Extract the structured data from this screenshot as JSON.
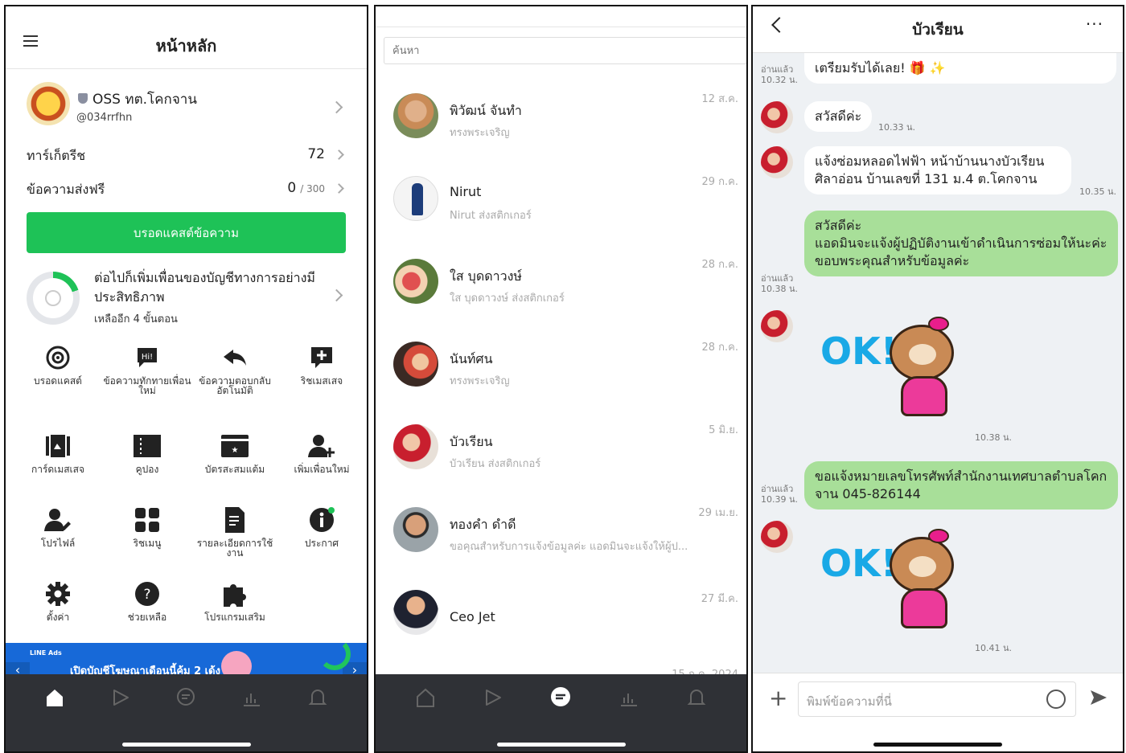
{
  "panel1": {
    "title": "หน้าหลัก",
    "account_name": "OSS ทต.โคกจาน",
    "account_id": "@034rrfhn",
    "targets_label": "ทาร์เก็ตรีช",
    "targets_value": "72",
    "free_msg_label": "ข้อความส่งฟรี",
    "free_msg_value": "0",
    "free_msg_total": "/ 300",
    "broadcast_button": "บรอดแคสต์ข้อความ",
    "progress_text": "ต่อไปก็เพิ่มเพื่อนของบัญชีทางการอย่างมีประสิทธิภาพ",
    "progress_sub": "เหลืออีก 4 ขั้นตอน",
    "progress_fraction": 0.2,
    "grid": [
      {
        "label": "บรอดแคสต์",
        "icon": "broadcast-icon"
      },
      {
        "label": "ข้อความทักทายเพื่อนใหม่",
        "icon": "greeting-hi-icon"
      },
      {
        "label": "ข้อความตอบกลับอัตโนมัติ",
        "icon": "reply-arrow-icon"
      },
      {
        "label": "ริชเมสเสจ",
        "icon": "rich-message-icon"
      },
      {
        "label": "การ์ดเมสเสจ",
        "icon": "card-message-icon"
      },
      {
        "label": "คูปอง",
        "icon": "coupon-icon"
      },
      {
        "label": "บัตรสะสมแต้ม",
        "icon": "reward-card-icon"
      },
      {
        "label": "เพิ่มเพื่อนใหม่",
        "icon": "add-friend-icon"
      },
      {
        "label": "โปรไฟล์",
        "icon": "profile-icon"
      },
      {
        "label": "ริชเมนู",
        "icon": "rich-menu-icon"
      },
      {
        "label": "รายละเอียดการใช้งาน",
        "icon": "usage-details-icon"
      },
      {
        "label": "ประกาศ",
        "icon": "announcement-icon"
      },
      {
        "label": "ตั้งค่า",
        "icon": "settings-gear-icon"
      },
      {
        "label": "ช่วยเหลือ",
        "icon": "help-icon"
      },
      {
        "label": "โปรแกรมเสริม",
        "icon": "plugin-puzzle-icon"
      }
    ],
    "banner_tag": "LINE Ads",
    "banner_text": "เปิดบัญชีโฆษณาเดือนนี้คุ้ม 2 เด้ง"
  },
  "panel2": {
    "search_placeholder": "ค้นหา",
    "chats": [
      {
        "name": "พิวัฒน์ จันทำ",
        "msg": "ทรงพระเจริญ",
        "date": "12 ส.ค."
      },
      {
        "name": "Nirut",
        "msg": "Nirut ส่งสติกเกอร์",
        "date": "29 ก.ค."
      },
      {
        "name": "ใส บุดดาวงษ์",
        "msg": "ใส บุดดาวงษ์ ส่งสติกเกอร์",
        "date": "28 ก.ค."
      },
      {
        "name": "นันท์ศน",
        "msg": "ทรงพระเจริญ",
        "date": "28 ก.ค."
      },
      {
        "name": "บัวเรียน",
        "msg": "บัวเรียน ส่งสติกเกอร์",
        "date": "5 มิ.ย."
      },
      {
        "name": "ทองคำ ดำดี",
        "msg": "ขอคุณสำหรับการแจ้งข้อมูลค่ะ แอดมินจะแจ้งให้ผู้ป...",
        "date": "29 เม.ย."
      },
      {
        "name": "Ceo Jet",
        "msg": "",
        "date": "27 มี.ค."
      }
    ],
    "last_date": "15 ก.ค. 2024"
  },
  "panel3": {
    "title": "บัวเรียน",
    "messages": [
      {
        "text": "เตรียมรับได้เลย! 🎁 ✨",
        "meta_read": "อ่านแล้ว",
        "time": "10.32 น."
      },
      {
        "text": "สวัสดีค่ะ",
        "time": "10.33 น."
      },
      {
        "text": "แจ้งซ่อมหลอดไฟฟ้า หน้าบ้านนางบัวเรียน ศิลาอ่อน บ้านเลขที่ 131 ม.4 ต.โคกจาน",
        "time": "10.35 น."
      },
      {
        "line1": "สวัสดีค่ะ",
        "line2": "แอดมินจะแจ้งผู้ปฏิบัติงานเข้าดำเนินการซ่อมให้นะค่ะ",
        "line3": "ขอบพระคุณสำหรับข้อมูลค่ะ",
        "meta_read": "อ่านแล้ว",
        "time": "10.38 น."
      },
      {
        "sticker": "OK!",
        "time": "10.38 น."
      },
      {
        "text": "ขอแจ้งหมายเลขโทรศัพท์สำนักงานเทศบาลตำบลโคกจาน 045-826144",
        "meta_read": "อ่านแล้ว",
        "time": "10.39 น."
      },
      {
        "sticker": "OK!",
        "time": "10.41 น."
      }
    ],
    "input_placeholder": "พิมพ์ข้อความที่นี่"
  }
}
